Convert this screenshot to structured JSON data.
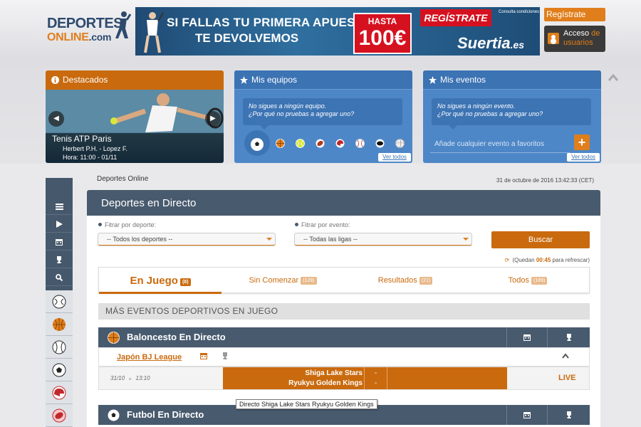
{
  "logo": {
    "line1": "DEPORTES",
    "line2": "ONLINE",
    "line2_suffix": ".com"
  },
  "banner": {
    "headline1": "SI FALLAS TU PRIMERA APUESTA",
    "headline2": "TE DEVOLVEMOS",
    "hasta": "HASTA",
    "amount": "100€",
    "cta": "REGÍSTRATE",
    "conditions": "Consulta condiciones",
    "brand": "Suertia",
    "brand_suffix": ".es"
  },
  "header": {
    "register_label": "Regístrate",
    "login_label": "Acceso de usuarios",
    "login_line1": "Acceso",
    "login_line1b": "de",
    "login_line2": "usuarios"
  },
  "cards": {
    "destacados": {
      "title": "Destacados",
      "event": "Tenis ATP Paris",
      "players": "Herbert P.H. - Lopez F.",
      "time": "Hora: 11:00 - 01/11"
    },
    "equipos": {
      "title": "Mis equipos",
      "message_line1": "No sigues a ningún equipo.",
      "message_line2": "¿Por qué no pruebas a agregar uno?",
      "see_all": "Ver todos",
      "sports": [
        "football-icon",
        "basketball-icon",
        "tennis-icon",
        "american-football-icon",
        "hockey-helmet-icon",
        "baseball-icon",
        "hockey-puck-icon",
        "volleyball-icon"
      ]
    },
    "eventos": {
      "title": "Mis eventos",
      "message_line1": "No sigues a ningún evento.",
      "message_line2": "¿Por qué no pruebas a agregar uno?",
      "input_placeholder": "Añade cualquier evento a favoritos",
      "add_label": "+",
      "see_all": "Ver todos"
    }
  },
  "sidebar": {
    "items": [
      "menu-icon",
      "play-icon",
      "calendar-icon",
      "trophy-icon",
      "search-icon"
    ],
    "sports": [
      "football-icon",
      "basketball-icon",
      "baseball-icon",
      "soccer-icon",
      "helmet-icon",
      "rugby-icon"
    ]
  },
  "breadcrumb": "Deportes Online",
  "datetime": "31 de octubre de 2016  13:42:33 (CET)",
  "panel_title": "Deportes en Directo",
  "filters": {
    "sport_label": "Fitrar por deporte:",
    "sport_value": "-- Todos los deportes --",
    "event_label": "Fitrar por evento:",
    "event_value": "-- Todas las ligas --",
    "search_label": "Buscar",
    "refresh_prefix": "(Quedan",
    "refresh_time": "00:45",
    "refresh_suffix": "para refrescar)"
  },
  "tabs": [
    {
      "label": "En Juego",
      "count": "(8)"
    },
    {
      "label": "Sin Comenzar",
      "count": "(128)"
    },
    {
      "label": "Resultados",
      "count": "(21)"
    },
    {
      "label": "Todos",
      "count": "(189)"
    }
  ],
  "more_events": "MÁS EVENTOS DEPORTIVOS EN JUEGO",
  "sections": {
    "basketball": {
      "title": "Baloncesto En Directo",
      "league": "Japón BJ League",
      "event": {
        "date": "31/10",
        "time": "13:10",
        "home": "Shiga Lake Stars",
        "away": "Ryukyu Golden Kings",
        "home_score": "-",
        "away_score": "-",
        "status": "LIVE"
      }
    },
    "football": {
      "title": "Futbol En Directo"
    }
  },
  "tooltip": "Directo Shiga Lake Stars Ryukyu Golden Kings",
  "colors": {
    "accent": "#c96a0e",
    "header_dark": "#485a6e",
    "blue_card": "#4e87c7"
  }
}
